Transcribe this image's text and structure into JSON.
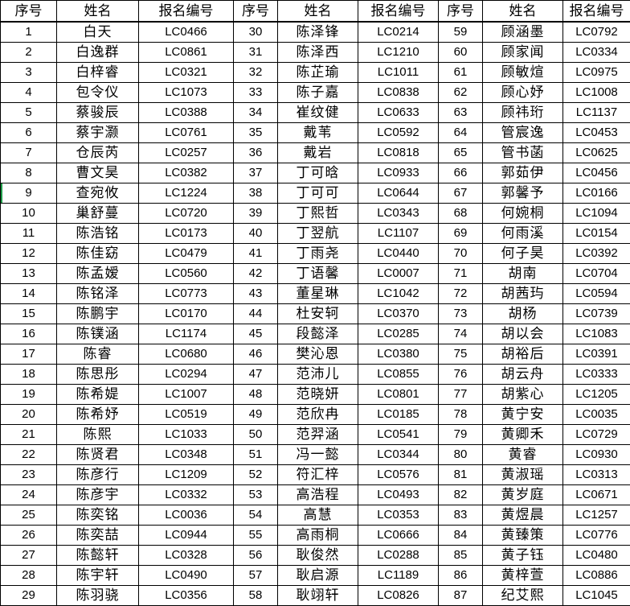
{
  "spreadsheet": {
    "accent_color": "#1e9c48",
    "grid_line_color": "#000000",
    "background_color": "#ffffff",
    "active_row_seq": "9",
    "columns_per_block": 3,
    "blocks": 3,
    "rows_per_block": 29,
    "total_entries": 87
  },
  "headers": [
    "序号",
    "姓名",
    "报名编号",
    "序号",
    "姓名",
    "报名编号",
    "序号",
    "姓名",
    "报名编号"
  ],
  "rows": [
    [
      [
        "1",
        "白天",
        "LC0466"
      ],
      [
        "30",
        "陈泽锋",
        "LC0214"
      ],
      [
        "59",
        "顾涵墨",
        "LC0792"
      ]
    ],
    [
      [
        "2",
        "白逸群",
        "LC0861"
      ],
      [
        "31",
        "陈泽西",
        "LC1210"
      ],
      [
        "60",
        "顾家闻",
        "LC0334"
      ]
    ],
    [
      [
        "3",
        "白梓睿",
        "LC0321"
      ],
      [
        "32",
        "陈芷瑜",
        "LC1011"
      ],
      [
        "61",
        "顾敏煊",
        "LC0975"
      ]
    ],
    [
      [
        "4",
        "包令仪",
        "LC1073"
      ],
      [
        "33",
        "陈子嘉",
        "LC0838"
      ],
      [
        "62",
        "顾心妤",
        "LC1008"
      ]
    ],
    [
      [
        "5",
        "蔡骏辰",
        "LC0388"
      ],
      [
        "34",
        "崔纹健",
        "LC0633"
      ],
      [
        "63",
        "顾祎珩",
        "LC1137"
      ]
    ],
    [
      [
        "6",
        "蔡宇灏",
        "LC0761"
      ],
      [
        "35",
        "戴苇",
        "LC0592"
      ],
      [
        "64",
        "管宸逸",
        "LC0453"
      ]
    ],
    [
      [
        "7",
        "仓辰芮",
        "LC0257"
      ],
      [
        "36",
        "戴岩",
        "LC0818"
      ],
      [
        "65",
        "管书菡",
        "LC0625"
      ]
    ],
    [
      [
        "8",
        "曹文昊",
        "LC0382"
      ],
      [
        "37",
        "丁可晗",
        "LC0933"
      ],
      [
        "66",
        "郭茹伊",
        "LC0456"
      ]
    ],
    [
      [
        "9",
        "查宛攸",
        "LC1224"
      ],
      [
        "38",
        "丁可可",
        "LC0644"
      ],
      [
        "67",
        "郭馨予",
        "LC0166"
      ]
    ],
    [
      [
        "10",
        "巢舒蔓",
        "LC0720"
      ],
      [
        "39",
        "丁熙哲",
        "LC0343"
      ],
      [
        "68",
        "何婉桐",
        "LC1094"
      ]
    ],
    [
      [
        "11",
        "陈浩铭",
        "LC0173"
      ],
      [
        "40",
        "丁翌航",
        "LC1107"
      ],
      [
        "69",
        "何雨溪",
        "LC0154"
      ]
    ],
    [
      [
        "12",
        "陈佳窈",
        "LC0479"
      ],
      [
        "41",
        "丁雨尧",
        "LC0440"
      ],
      [
        "70",
        "何子昊",
        "LC0392"
      ]
    ],
    [
      [
        "13",
        "陈孟嫒",
        "LC0560"
      ],
      [
        "42",
        "丁语馨",
        "LC0007"
      ],
      [
        "71",
        "胡南",
        "LC0704"
      ]
    ],
    [
      [
        "14",
        "陈铭泽",
        "LC0773"
      ],
      [
        "43",
        "董星琳",
        "LC1042"
      ],
      [
        "72",
        "胡茜玙",
        "LC0594"
      ]
    ],
    [
      [
        "15",
        "陈鹏宇",
        "LC0170"
      ],
      [
        "44",
        "杜安轲",
        "LC0370"
      ],
      [
        "73",
        "胡杨",
        "LC0739"
      ]
    ],
    [
      [
        "16",
        "陈镤涵",
        "LC1174"
      ],
      [
        "45",
        "段懿泽",
        "LC0285"
      ],
      [
        "74",
        "胡以会",
        "LC1083"
      ]
    ],
    [
      [
        "17",
        "陈睿",
        "LC0680"
      ],
      [
        "46",
        "樊沁恩",
        "LC0380"
      ],
      [
        "75",
        "胡裕后",
        "LC0391"
      ]
    ],
    [
      [
        "18",
        "陈思彤",
        "LC0294"
      ],
      [
        "47",
        "范沛儿",
        "LC0855"
      ],
      [
        "76",
        "胡云舟",
        "LC0333"
      ]
    ],
    [
      [
        "19",
        "陈希媞",
        "LC1007"
      ],
      [
        "48",
        "范晓妍",
        "LC0801"
      ],
      [
        "77",
        "胡紫心",
        "LC1205"
      ]
    ],
    [
      [
        "20",
        "陈希妤",
        "LC0519"
      ],
      [
        "49",
        "范欣冉",
        "LC0185"
      ],
      [
        "78",
        "黄宁安",
        "LC0035"
      ]
    ],
    [
      [
        "21",
        "陈熙",
        "LC1033"
      ],
      [
        "50",
        "范羿涵",
        "LC0541"
      ],
      [
        "79",
        "黄卿禾",
        "LC0729"
      ]
    ],
    [
      [
        "22",
        "陈贤君",
        "LC0348"
      ],
      [
        "51",
        "冯一懿",
        "LC0344"
      ],
      [
        "80",
        "黄睿",
        "LC0930"
      ]
    ],
    [
      [
        "23",
        "陈彦行",
        "LC1209"
      ],
      [
        "52",
        "符汇梓",
        "LC0576"
      ],
      [
        "81",
        "黄淑瑶",
        "LC0313"
      ]
    ],
    [
      [
        "24",
        "陈彦宇",
        "LC0332"
      ],
      [
        "53",
        "高浩程",
        "LC0493"
      ],
      [
        "82",
        "黄岁庭",
        "LC0671"
      ]
    ],
    [
      [
        "25",
        "陈奕铭",
        "LC0036"
      ],
      [
        "54",
        "高慧",
        "LC0353"
      ],
      [
        "83",
        "黄煜晨",
        "LC1257"
      ]
    ],
    [
      [
        "26",
        "陈奕喆",
        "LC0944"
      ],
      [
        "55",
        "高雨桐",
        "LC0666"
      ],
      [
        "84",
        "黄臻策",
        "LC0776"
      ]
    ],
    [
      [
        "27",
        "陈懿轩",
        "LC0328"
      ],
      [
        "56",
        "耿俊然",
        "LC0288"
      ],
      [
        "85",
        "黄子钰",
        "LC0480"
      ]
    ],
    [
      [
        "28",
        "陈宇轩",
        "LC0490"
      ],
      [
        "57",
        "耿启源",
        "LC1189"
      ],
      [
        "86",
        "黄梓萱",
        "LC0886"
      ]
    ],
    [
      [
        "29",
        "陈羽骁",
        "LC0356"
      ],
      [
        "58",
        "耿翊轩",
        "LC0826"
      ],
      [
        "87",
        "纪艾熙",
        "LC1045"
      ]
    ]
  ]
}
